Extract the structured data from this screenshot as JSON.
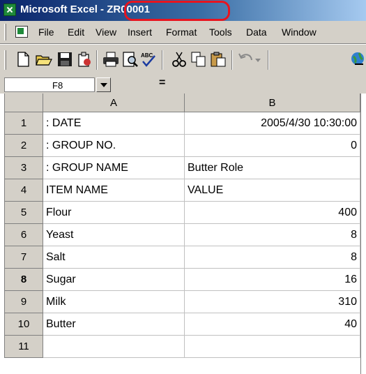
{
  "window": {
    "title_prefix": "Microsoft Excel ",
    "title_suffix": "- ZR00001"
  },
  "menu": [
    {
      "label": "File"
    },
    {
      "label": "Edit"
    },
    {
      "label": "View"
    },
    {
      "label": "Insert"
    },
    {
      "label": "Format"
    },
    {
      "label": "Tools"
    },
    {
      "label": "Data"
    },
    {
      "label": "Window"
    }
  ],
  "toolbar_icons": [
    "new-icon",
    "open-icon",
    "save-icon",
    "permission-icon",
    "print-icon",
    "print-preview-icon",
    "spelling-icon",
    "cut-icon",
    "copy-icon",
    "paste-icon",
    "undo-icon",
    "hyperlink-icon"
  ],
  "formula_bar": {
    "name_box": "F8",
    "equals": "="
  },
  "sheet": {
    "columns": [
      "A",
      "B"
    ],
    "rows": [
      {
        "num": "1",
        "a": ": DATE",
        "b": "2005/4/30 10:30:00"
      },
      {
        "num": "2",
        "a": ": GROUP NO.",
        "b": "0"
      },
      {
        "num": "3",
        "a": ": GROUP NAME",
        "b": "Butter Role"
      },
      {
        "num": "4",
        "a": "ITEM NAME",
        "b": "VALUE"
      },
      {
        "num": "5",
        "a": "Flour",
        "b": "400"
      },
      {
        "num": "6",
        "a": "Yeast",
        "b": "8"
      },
      {
        "num": "7",
        "a": "Salt",
        "b": "8"
      },
      {
        "num": "8",
        "a": "Sugar",
        "b": "16"
      },
      {
        "num": "9",
        "a": "Milk",
        "b": "310"
      },
      {
        "num": "10",
        "a": "Butter",
        "b": "40"
      },
      {
        "num": "11",
        "a": "",
        "b": ""
      }
    ]
  },
  "colors": {
    "highlight": "#e8141e",
    "titlebar_start": "#0a246a",
    "titlebar_end": "#a6caf0"
  }
}
